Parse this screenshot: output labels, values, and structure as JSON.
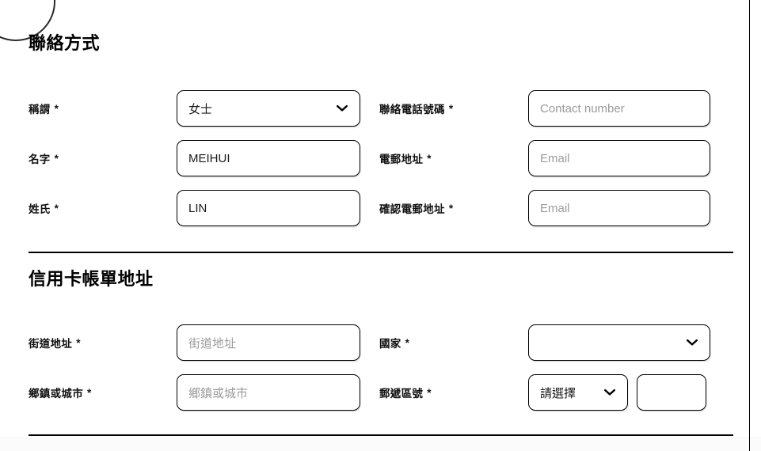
{
  "sections": [
    {
      "id": "contact",
      "title": "聯絡方式",
      "fields_left": [
        {
          "label": "稱謂",
          "required_marker": "*",
          "control": "select",
          "value": "女士",
          "placeholder": "",
          "icon": "chevron-down-icon",
          "name": "title-select"
        },
        {
          "label": "名字",
          "required_marker": "*",
          "control": "text",
          "value": "MEIHUI",
          "placeholder": "",
          "name": "first-name-input"
        },
        {
          "label": "姓氏",
          "required_marker": "*",
          "control": "text",
          "value": "LIN",
          "placeholder": "",
          "name": "last-name-input"
        }
      ],
      "fields_right": [
        {
          "label": "聯絡電話號碼",
          "required_marker": "*",
          "control": "text",
          "value": "",
          "placeholder": "Contact number",
          "name": "contact-number-input"
        },
        {
          "label": "電郵地址",
          "required_marker": "*",
          "control": "text",
          "value": "",
          "placeholder": "Email",
          "name": "email-input"
        },
        {
          "label": "確認電郵地址",
          "required_marker": "*",
          "control": "text",
          "value": "",
          "placeholder": "Email",
          "name": "confirm-email-input"
        }
      ]
    },
    {
      "id": "billing",
      "title": "信用卡帳單地址",
      "fields_left": [
        {
          "label": "街道地址",
          "required_marker": "*",
          "control": "text",
          "value": "",
          "placeholder": "街道地址",
          "name": "street-address-input"
        },
        {
          "label": "鄉鎮或城市",
          "required_marker": "*",
          "control": "text",
          "value": "",
          "placeholder": "鄉鎮或城市",
          "name": "city-input"
        }
      ],
      "fields_right": [
        {
          "label": "國家",
          "required_marker": "*",
          "control": "select",
          "value": "",
          "placeholder": "",
          "icon": "chevron-down-icon",
          "name": "country-select"
        },
        {
          "label": "郵遞區號",
          "required_marker": "*",
          "control": "select-plus-input",
          "value": "請選擇",
          "secondary_value": "",
          "placeholder": "",
          "icon": "chevron-down-icon",
          "name": "postal-code-group"
        }
      ]
    }
  ],
  "colors": {
    "border": "#000000",
    "text": "#111111",
    "placeholder": "#9b9b9b",
    "page_background": "#ffffff",
    "underlay": "#fbfbfb"
  }
}
